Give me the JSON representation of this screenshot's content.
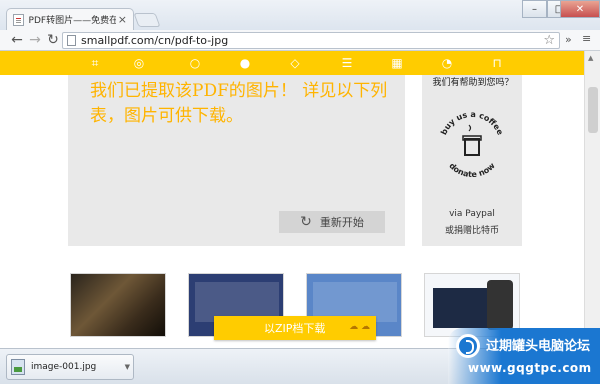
{
  "browser": {
    "tab_title": "PDF转图片——免费在线",
    "tab_close": "×",
    "url": "smallpdf.com/cn/pdf-to-jpg",
    "window_controls": {
      "minimize": "–",
      "maximize": "□",
      "close": "✕"
    }
  },
  "page": {
    "result_message": "我们已提取该PDF的图片！ 详见以下列表，图片可供下载。",
    "restart_label": "重新开始",
    "coffee": {
      "question": "我们有帮助到您吗？",
      "badge_top": "buy us a coffee",
      "badge_bottom": "donate now",
      "via_paypal": "via Paypal",
      "donate_cn": "或捐赠比特币"
    },
    "zip_download_label": "以ZIP档下载",
    "toolbar_icons": [
      "crop-icon",
      "globe-icon",
      "bell-icon",
      "circles-icon",
      "tag-icon",
      "list-icon",
      "grid-icon",
      "pie-icon",
      "lock-icon"
    ],
    "brand_color": "#ffcc00"
  },
  "downloads": {
    "file_name": "image-001.jpg"
  },
  "watermark": {
    "title": "过期罐头电脑论坛",
    "url": "www.gqgtpc.com"
  }
}
